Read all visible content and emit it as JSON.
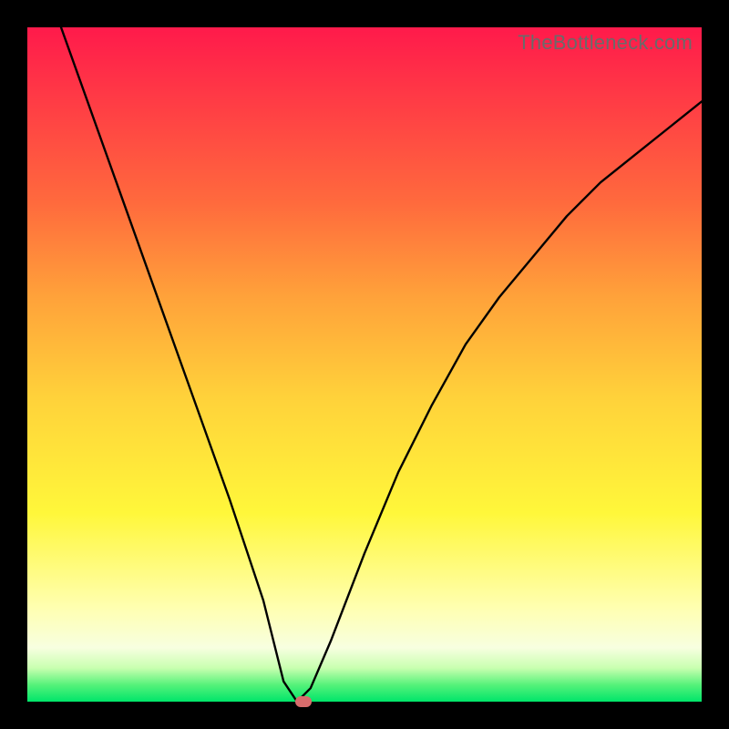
{
  "brand": "TheBottleneck.com",
  "colors": {
    "frame": "#000000",
    "curve": "#000000",
    "dot": "#d76c6c",
    "gradient_top": "#ff1a4b",
    "gradient_bottom": "#00e56a"
  },
  "chart_data": {
    "type": "line",
    "title": "",
    "xlabel": "",
    "ylabel": "",
    "xlim": [
      0,
      1
    ],
    "ylim": [
      0,
      1
    ],
    "min_x": 0.4,
    "series": [
      {
        "name": "curve",
        "x": [
          0.0,
          0.05,
          0.1,
          0.15,
          0.2,
          0.25,
          0.3,
          0.35,
          0.38,
          0.4,
          0.42,
          0.45,
          0.5,
          0.55,
          0.6,
          0.65,
          0.7,
          0.75,
          0.8,
          0.85,
          0.9,
          0.95,
          1.0
        ],
        "y": [
          1.13,
          1.0,
          0.86,
          0.72,
          0.58,
          0.44,
          0.3,
          0.15,
          0.03,
          0.0,
          0.02,
          0.09,
          0.22,
          0.34,
          0.44,
          0.53,
          0.6,
          0.66,
          0.72,
          0.77,
          0.81,
          0.85,
          0.89
        ]
      }
    ],
    "marker": {
      "x": 0.41,
      "y": 0.0
    }
  }
}
